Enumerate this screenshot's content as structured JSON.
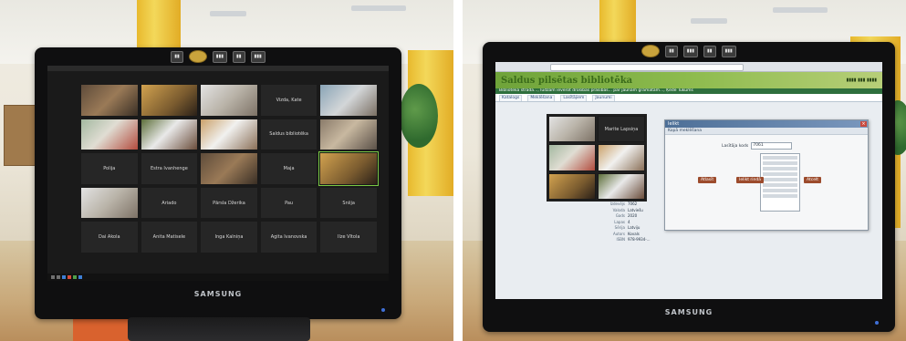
{
  "monitor_brand": "SAMSUNG",
  "left_photo": {
    "zoom_tiles": [
      {
        "type": "video",
        "label": ""
      },
      {
        "type": "video",
        "label": ""
      },
      {
        "type": "video",
        "label": ""
      },
      {
        "type": "name",
        "label": "Vizda, Kate"
      },
      {
        "type": "video",
        "label": ""
      },
      {
        "type": "video",
        "label": ""
      },
      {
        "type": "video",
        "label": ""
      },
      {
        "type": "video",
        "label": ""
      },
      {
        "type": "name",
        "label": "Saldus bibliotēka"
      },
      {
        "type": "video",
        "label": ""
      },
      {
        "type": "name",
        "label": "Polija"
      },
      {
        "type": "name",
        "label": "Estra Ivanhenge"
      },
      {
        "type": "video",
        "label": ""
      },
      {
        "type": "name",
        "label": "Maja"
      },
      {
        "type": "video",
        "label": "",
        "active": true
      },
      {
        "type": "video",
        "label": ""
      },
      {
        "type": "name",
        "label": "Ariado"
      },
      {
        "type": "name",
        "label": "Pārsla Džerika"
      },
      {
        "type": "name",
        "label": "Pau"
      },
      {
        "type": "name",
        "label": "Sniija"
      },
      {
        "type": "name",
        "label": "Dai Akola"
      },
      {
        "type": "name",
        "label": "Anita Matisele"
      },
      {
        "type": "name",
        "label": "Inga Kalniņa"
      },
      {
        "type": "name",
        "label": "Agita Ivanovska"
      },
      {
        "type": "name",
        "label": "Ilze Vītola"
      }
    ]
  },
  "right_photo": {
    "site_title": "Saldus pilsētas bibliotēka",
    "marquee": "Bibliotēka strādā..., lūdzam ievērot drošības prasības... par jaunām grāmatām..., Ķēde Tukums",
    "nav_tabs": [
      "Katalogs",
      "Meklēšana",
      "Lasītājiem",
      "Jaunumi"
    ],
    "dialog_title": "Ielikt",
    "dialog_subtitle": "Kopā meklēšana",
    "dialog_field_label": "Lasītāja kods",
    "dialog_field_value": "7061",
    "dialog_buttons": [
      "Atlasīt",
      "Ielikt rindā",
      "Atcelt"
    ],
    "overlay_name": "Marite Lapsiņa",
    "details": [
      {
        "key": "Izdevējs",
        "val": "7062"
      },
      {
        "key": "Valoda",
        "val": "Latviešu"
      },
      {
        "key": "Gads",
        "val": "2020"
      },
      {
        "key": "Lapas",
        "val": "4"
      },
      {
        "key": "Sērija",
        "val": "Latviju"
      },
      {
        "key": "Autors",
        "val": "Kovals"
      },
      {
        "key": "ISBN",
        "val": "978-9934-..."
      }
    ]
  }
}
